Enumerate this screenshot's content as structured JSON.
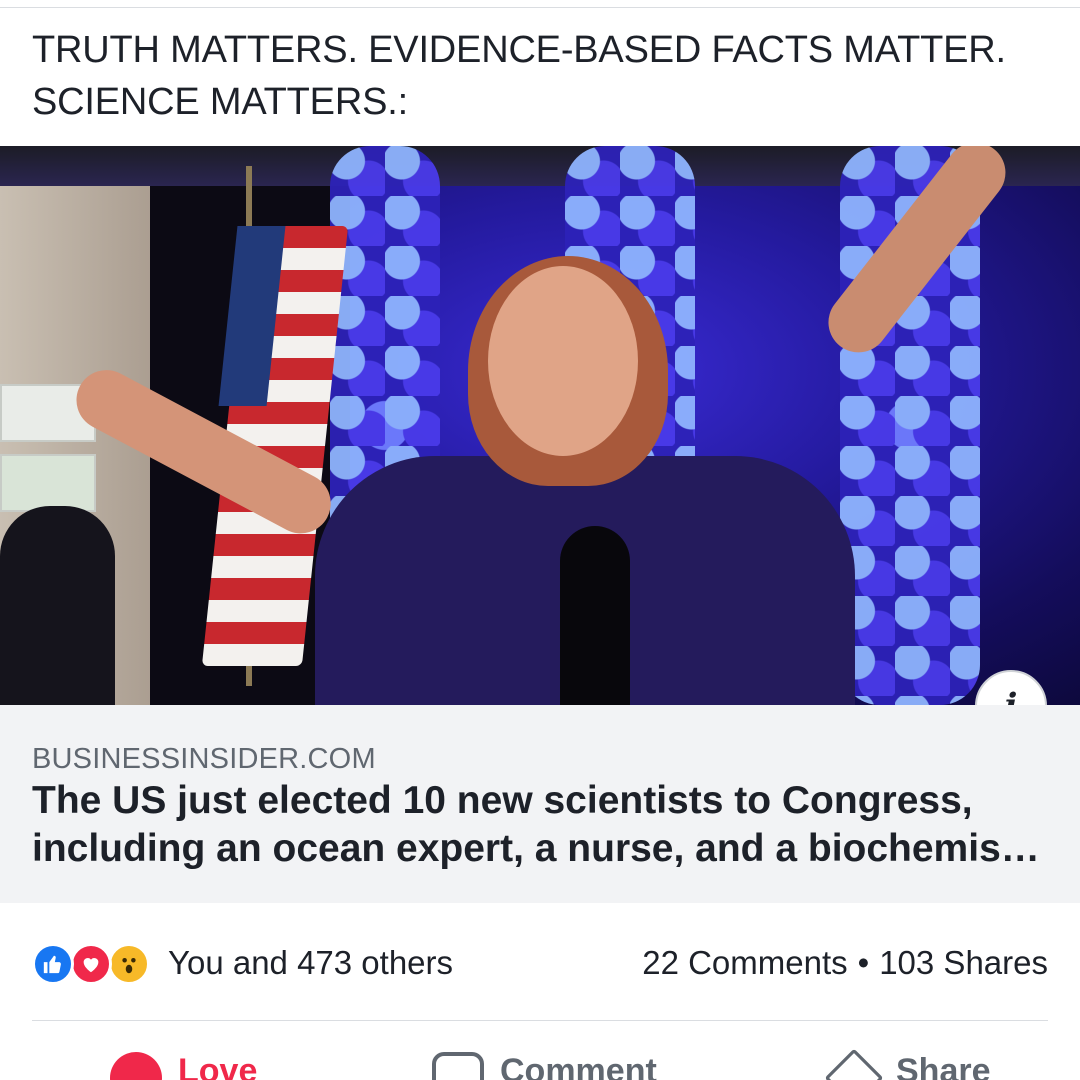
{
  "post": {
    "text": "TRUTH MATTERS. EVIDENCE-BASED FACTS MATTER. SCIENCE MATTERS.:"
  },
  "link": {
    "domain": "BUSINESSINSIDER.COM",
    "title": "The US just elected 10 new scientists to Congress, including an ocean expert, a nurse, and a biochemis…",
    "info_glyph": "i"
  },
  "reactions": {
    "icons": [
      "like-icon",
      "love-icon",
      "wow-icon"
    ],
    "summary": "You and 473 others",
    "comments": "22 Comments",
    "separator": "•",
    "shares": "103 Shares"
  },
  "actions": {
    "love_label": "Love",
    "comment_label": "Comment",
    "share_label": "Share"
  },
  "colors": {
    "like": "#1877f2",
    "love": "#f0284a",
    "wow": "#f7b928",
    "meta_bg": "#f2f3f5"
  }
}
